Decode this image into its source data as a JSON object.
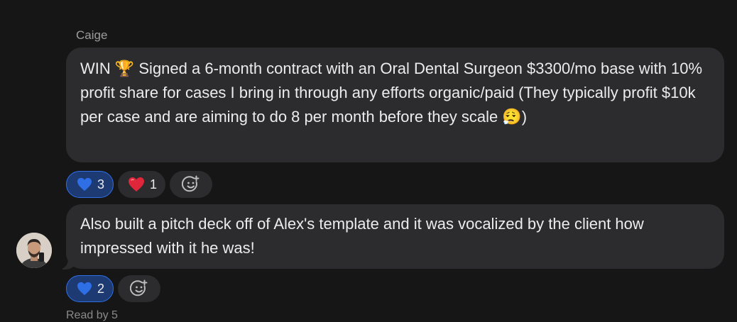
{
  "messages": [
    {
      "sender": "Caige",
      "text": "WIN 🏆 Signed a 6-month contract with an Oral Dental Surgeon $3300/mo base with 10% profit share for cases I bring in through any efforts organic/paid (They typically profit $10k per case and are aiming to do 8 per month before they scale 😮‍💨)",
      "reactions": [
        {
          "emoji": "blue-heart",
          "count": "3",
          "mine": true
        },
        {
          "emoji": "red-heart",
          "count": "1",
          "mine": false
        }
      ]
    },
    {
      "text": "Also built a pitch deck off of Alex's template and it was vocalized by the client how impressed with it he was!",
      "reactions": [
        {
          "emoji": "blue-heart",
          "count": "2",
          "mine": true
        }
      ]
    }
  ],
  "next_message_cutoff": "Read by 5",
  "colors": {
    "background": "#161616",
    "bubble": "#2c2c2e",
    "own_reaction_bg": "#1d3a73",
    "own_reaction_border": "#2f6fe8",
    "blue_heart": "#2e6fe6",
    "red_heart": "#e0263a"
  }
}
